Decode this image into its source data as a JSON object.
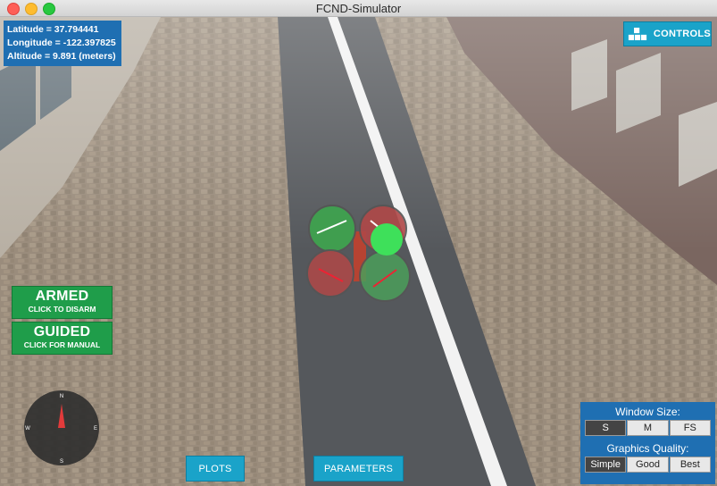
{
  "window": {
    "title": "FCND-Simulator"
  },
  "telemetry": {
    "latitude": "Latitude = 37.794441",
    "longitude": "Longitude = -122.397825",
    "altitude": "Altitude = 9.891 (meters)"
  },
  "controls_button": {
    "label": "CONTROLS",
    "icon": "keyboard-keys-icon"
  },
  "armed_button": {
    "title": "ARMED",
    "subtitle": "CLICK TO DISARM"
  },
  "guided_button": {
    "title": "GUIDED",
    "subtitle": "CLICK FOR MANUAL"
  },
  "compass": {
    "n": "N",
    "s": "S",
    "e": "E",
    "w": "W",
    "icon": "compass-needle-icon"
  },
  "bottom": {
    "plots": "PLOTS",
    "parameters": "PARAMETERS"
  },
  "window_size": {
    "label": "Window Size:",
    "options": [
      "S",
      "M",
      "FS"
    ],
    "selected": "S"
  },
  "graphics_quality": {
    "label": "Graphics Quality:",
    "options": [
      "Simple",
      "Good",
      "Best"
    ],
    "selected": "Simple"
  },
  "colors": {
    "accent": "#1aa3c9",
    "hud_blue": "#1f6fb2",
    "armed_green": "#1f9d4a"
  }
}
